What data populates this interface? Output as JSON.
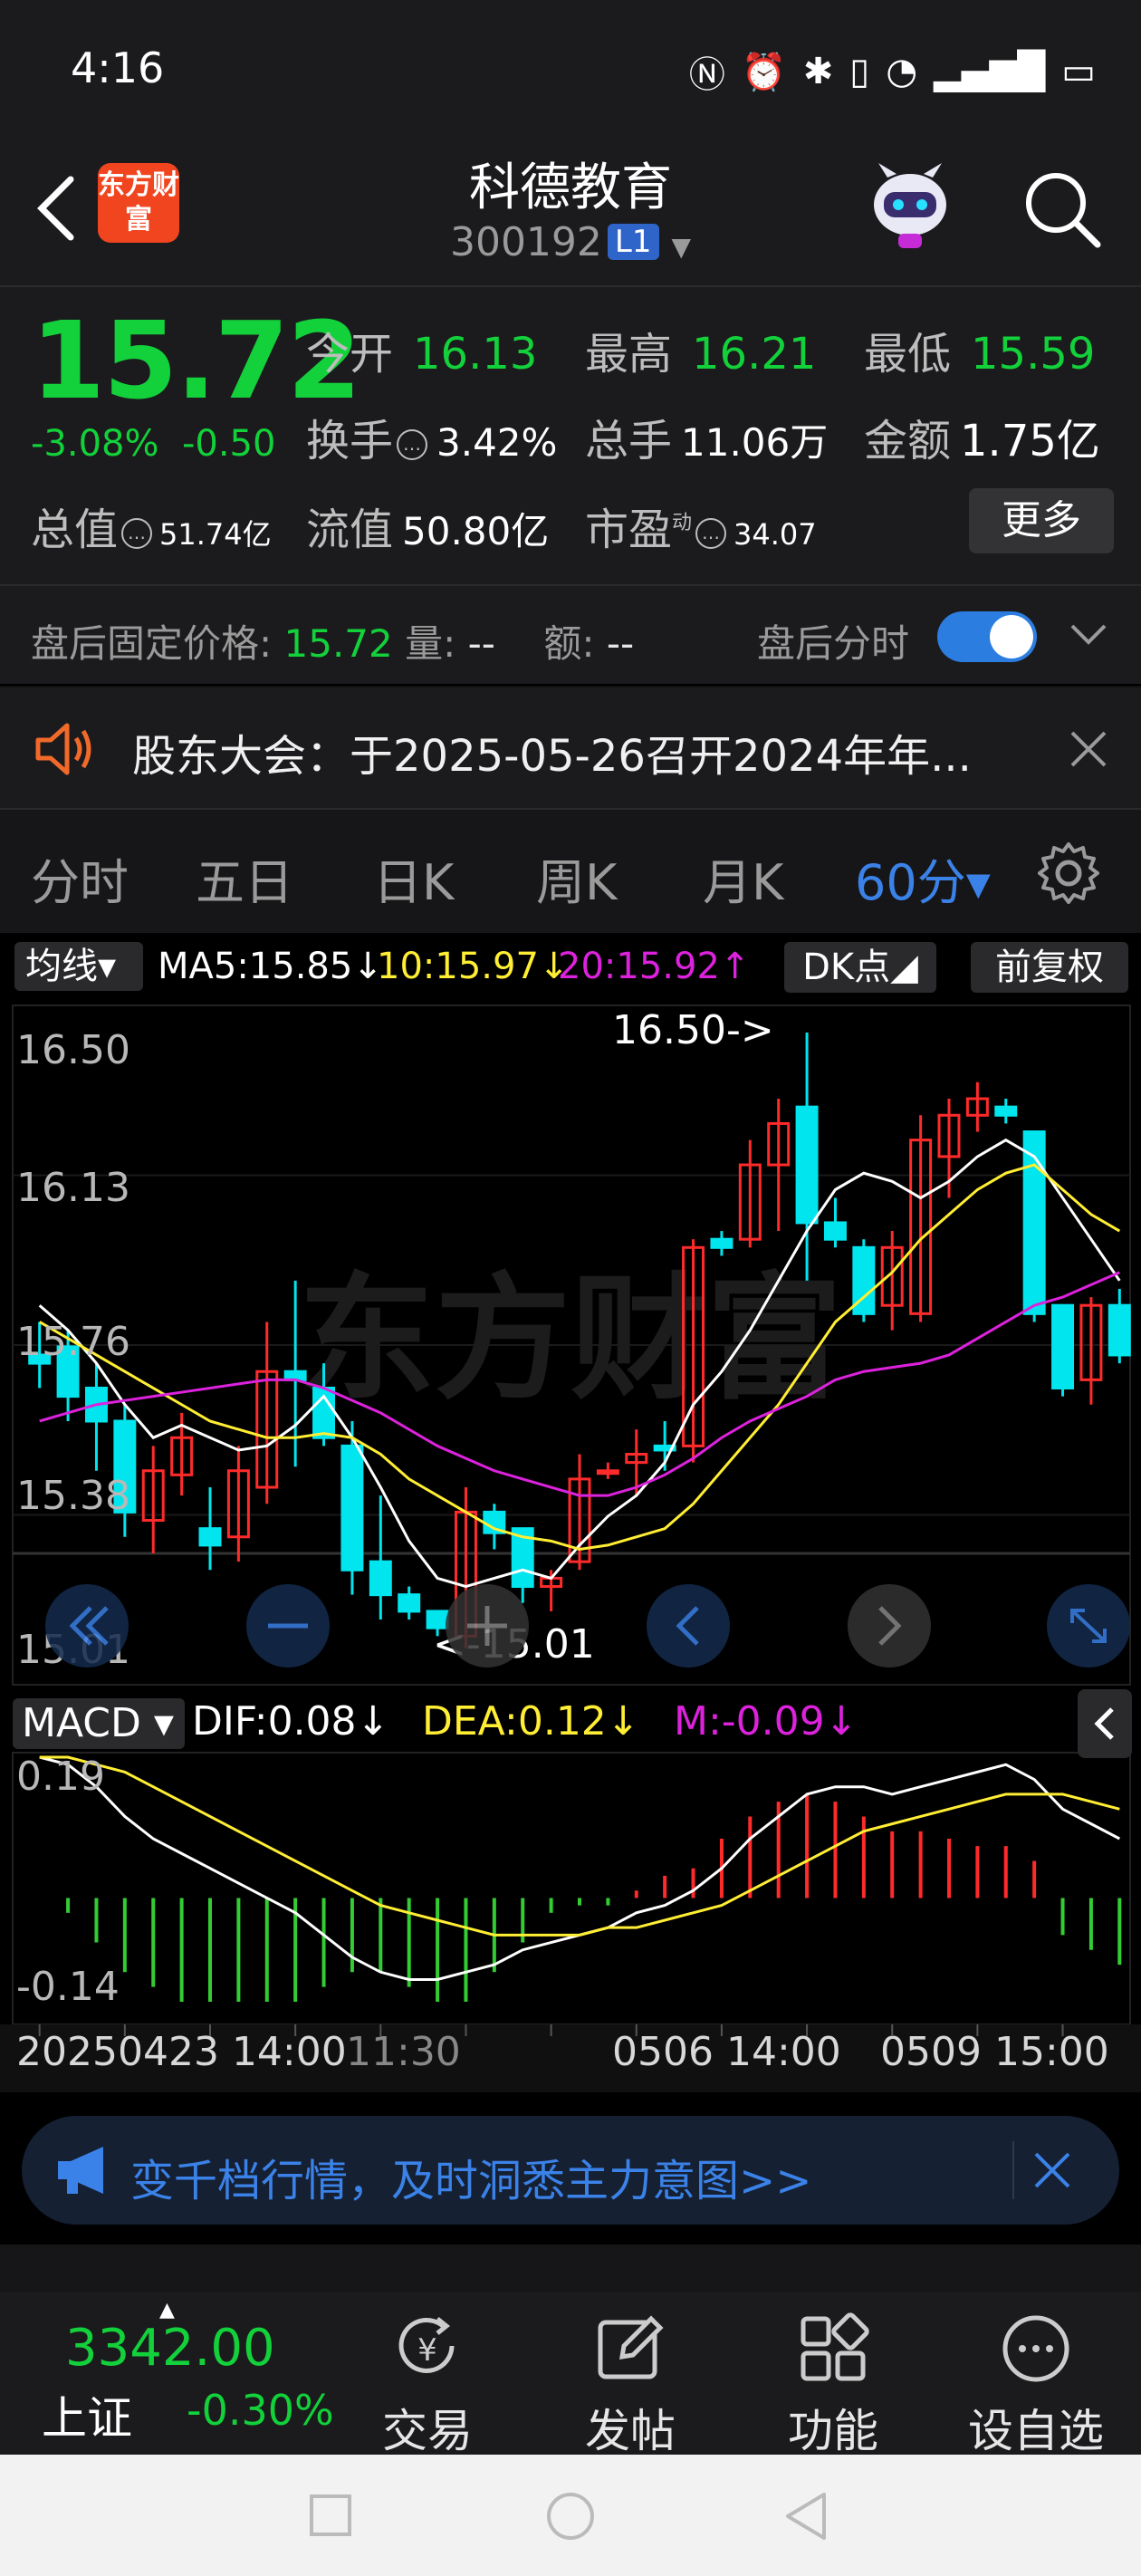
{
  "status_bar": {
    "time": "4:16"
  },
  "header": {
    "stock_name": "科德教育",
    "stock_code": "300192",
    "level_badge": "L1",
    "brand_text": "东方财富"
  },
  "quote": {
    "price": "15.72",
    "change_pct": "-3.08%",
    "change": "-0.50",
    "open_label": "今开",
    "open": "16.13",
    "high_label": "最高",
    "high": "16.21",
    "low_label": "最低",
    "low": "15.59",
    "turnover_label": "换手",
    "turnover": "3.42%",
    "volume_label": "总手",
    "volume": "11.06万",
    "amount_label": "金额",
    "amount": "1.75亿",
    "mktcap_label": "总值",
    "mktcap": "51.74亿",
    "float_label": "流值",
    "float": "50.80亿",
    "pe_label": "市盈",
    "pe_super": "动",
    "pe": "34.07",
    "more_label": "更多"
  },
  "after_hours": {
    "price_label": "盘后固定价格:",
    "price": "15.72",
    "volume_label": "量:",
    "volume": "--",
    "amount_label": "额:",
    "amount": "--",
    "minute_label": "盘后分时"
  },
  "notice": {
    "text": "股东大会：于2025-05-26召开2024年年..."
  },
  "period_tabs": [
    "分时",
    "五日",
    "日K",
    "周K",
    "月K",
    "60分▾"
  ],
  "ma_bar": {
    "selector": "均线▾",
    "ma5": "MA5:15.85↓",
    "ma10": "10:15.97↓",
    "ma20": "20:15.92↑",
    "dk": "DK点◢",
    "adjust": "前复权"
  },
  "price_axis": [
    "16.50",
    "16.13",
    "15.76",
    "15.38",
    "15.01"
  ],
  "annotations": {
    "high": "16.50->",
    "low": "<-15.01",
    "watermark": "东方财富"
  },
  "macd_bar": {
    "selector": "MACD ▾",
    "dif": "DIF:0.08↓",
    "dea": "DEA:0.12↓",
    "m": "M:-0.09↓"
  },
  "macd_axis": [
    "0.19",
    "-0.14"
  ],
  "time_axis": [
    "20250423 14:00",
    "11:30",
    "0506 14:00",
    "0509 15:00"
  ],
  "promo": {
    "text": "变千档行情，及时洞悉主力意图>>"
  },
  "bottom_nav": {
    "index_value": "3342.00",
    "index_name": "上证",
    "index_change": "-0.30%",
    "items": [
      "交易",
      "发帖",
      "功能",
      "设自选"
    ]
  },
  "colors": {
    "up": "#ff2b2b",
    "down": "#00e5ee",
    "ma5": "#ffffff",
    "ma10": "#ffee33",
    "ma20": "#dd22dd",
    "accent": "#3b82e8"
  },
  "chart_data": {
    "type": "candlestick",
    "interval": "60分",
    "ylim": [
      15.01,
      16.5
    ],
    "candles": [
      {
        "o": 15.72,
        "h": 15.8,
        "l": 15.64,
        "c": 15.7
      },
      {
        "o": 15.74,
        "h": 15.78,
        "l": 15.56,
        "c": 15.62
      },
      {
        "o": 15.64,
        "h": 15.7,
        "l": 15.44,
        "c": 15.56
      },
      {
        "o": 15.56,
        "h": 15.6,
        "l": 15.28,
        "c": 15.34
      },
      {
        "o": 15.32,
        "h": 15.5,
        "l": 15.24,
        "c": 15.44
      },
      {
        "o": 15.43,
        "h": 15.58,
        "l": 15.38,
        "c": 15.52
      },
      {
        "o": 15.3,
        "h": 15.4,
        "l": 15.2,
        "c": 15.26
      },
      {
        "o": 15.28,
        "h": 15.5,
        "l": 15.22,
        "c": 15.44
      },
      {
        "o": 15.4,
        "h": 15.8,
        "l": 15.36,
        "c": 15.68
      },
      {
        "o": 15.68,
        "h": 15.9,
        "l": 15.45,
        "c": 15.66
      },
      {
        "o": 15.64,
        "h": 15.7,
        "l": 15.5,
        "c": 15.52
      },
      {
        "o": 15.5,
        "h": 15.56,
        "l": 15.14,
        "c": 15.2
      },
      {
        "o": 15.22,
        "h": 15.38,
        "l": 15.08,
        "c": 15.14
      },
      {
        "o": 15.14,
        "h": 15.16,
        "l": 15.08,
        "c": 15.1
      },
      {
        "o": 15.1,
        "h": 15.1,
        "l": 15.04,
        "c": 15.06
      },
      {
        "o": 15.04,
        "h": 15.4,
        "l": 15.01,
        "c": 15.34
      },
      {
        "o": 15.34,
        "h": 15.36,
        "l": 15.25,
        "c": 15.29
      },
      {
        "o": 15.3,
        "h": 15.3,
        "l": 15.12,
        "c": 15.16
      },
      {
        "o": 15.16,
        "h": 15.2,
        "l": 15.1,
        "c": 15.18
      },
      {
        "o": 15.22,
        "h": 15.48,
        "l": 15.2,
        "c": 15.42
      },
      {
        "o": 15.44,
        "h": 15.46,
        "l": 15.42,
        "c": 15.44
      },
      {
        "o": 15.46,
        "h": 15.54,
        "l": 15.38,
        "c": 15.48
      },
      {
        "o": 15.5,
        "h": 15.56,
        "l": 15.44,
        "c": 15.49
      },
      {
        "o": 15.5,
        "h": 16.0,
        "l": 15.46,
        "c": 15.98
      },
      {
        "o": 16.0,
        "h": 16.02,
        "l": 15.96,
        "c": 15.98
      },
      {
        "o": 16.0,
        "h": 16.24,
        "l": 15.98,
        "c": 16.18
      },
      {
        "o": 16.18,
        "h": 16.34,
        "l": 16.02,
        "c": 16.28
      },
      {
        "o": 16.32,
        "h": 16.5,
        "l": 15.9,
        "c": 16.04
      },
      {
        "o": 16.04,
        "h": 16.1,
        "l": 15.98,
        "c": 16.0
      },
      {
        "o": 15.98,
        "h": 16.0,
        "l": 15.8,
        "c": 15.82
      },
      {
        "o": 15.84,
        "h": 16.02,
        "l": 15.78,
        "c": 15.98
      },
      {
        "o": 15.82,
        "h": 16.3,
        "l": 15.8,
        "c": 16.24
      },
      {
        "o": 16.2,
        "h": 16.34,
        "l": 16.1,
        "c": 16.3
      },
      {
        "o": 16.3,
        "h": 16.38,
        "l": 16.26,
        "c": 16.34
      },
      {
        "o": 16.32,
        "h": 16.34,
        "l": 16.28,
        "c": 16.3
      },
      {
        "o": 16.26,
        "h": 16.26,
        "l": 15.8,
        "c": 15.82
      },
      {
        "o": 15.84,
        "h": 15.84,
        "l": 15.62,
        "c": 15.64
      },
      {
        "o": 15.66,
        "h": 15.86,
        "l": 15.6,
        "c": 15.84
      },
      {
        "o": 15.84,
        "h": 15.88,
        "l": 15.7,
        "c": 15.72
      }
    ],
    "ma5": [
      15.84,
      15.78,
      15.7,
      15.6,
      15.52,
      15.55,
      15.52,
      15.49,
      15.5,
      15.55,
      15.62,
      15.52,
      15.4,
      15.27,
      15.18,
      15.16,
      15.18,
      15.2,
      15.18,
      15.26,
      15.33,
      15.38,
      15.46,
      15.6,
      15.68,
      15.78,
      15.9,
      16.02,
      16.12,
      16.16,
      16.14,
      16.1,
      16.14,
      16.2,
      16.24,
      16.2,
      16.1,
      16.0,
      15.9
    ],
    "ma10": [
      15.8,
      15.76,
      15.72,
      15.68,
      15.64,
      15.6,
      15.56,
      15.54,
      15.52,
      15.52,
      15.53,
      15.52,
      15.48,
      15.42,
      15.38,
      15.34,
      15.3,
      15.28,
      15.27,
      15.25,
      15.26,
      15.28,
      15.3,
      15.36,
      15.44,
      15.52,
      15.6,
      15.7,
      15.8,
      15.86,
      15.92,
      16.0,
      16.06,
      16.12,
      16.16,
      16.18,
      16.12,
      16.06,
      16.02
    ],
    "ma20": [
      15.56,
      15.58,
      15.6,
      15.61,
      15.62,
      15.63,
      15.64,
      15.65,
      15.66,
      15.66,
      15.64,
      15.61,
      15.58,
      15.54,
      15.5,
      15.47,
      15.44,
      15.42,
      15.4,
      15.38,
      15.38,
      15.4,
      15.43,
      15.47,
      15.52,
      15.56,
      15.59,
      15.62,
      15.66,
      15.68,
      15.69,
      15.7,
      15.72,
      15.76,
      15.8,
      15.84,
      15.86,
      15.89,
      15.92
    ],
    "macd": {
      "ylim": [
        -0.14,
        0.19
      ],
      "dif": [
        0.19,
        0.18,
        0.15,
        0.11,
        0.08,
        0.06,
        0.04,
        0.02,
        0.0,
        -0.02,
        -0.05,
        -0.08,
        -0.1,
        -0.11,
        -0.11,
        -0.1,
        -0.09,
        -0.07,
        -0.06,
        -0.05,
        -0.04,
        -0.02,
        -0.01,
        0.01,
        0.04,
        0.08,
        0.11,
        0.14,
        0.15,
        0.15,
        0.14,
        0.15,
        0.16,
        0.17,
        0.18,
        0.16,
        0.12,
        0.1,
        0.08
      ],
      "dea": [
        0.19,
        0.19,
        0.18,
        0.17,
        0.15,
        0.13,
        0.11,
        0.09,
        0.07,
        0.05,
        0.03,
        0.01,
        -0.01,
        -0.02,
        -0.03,
        -0.04,
        -0.05,
        -0.05,
        -0.05,
        -0.05,
        -0.04,
        -0.04,
        -0.03,
        -0.02,
        -0.01,
        0.01,
        0.03,
        0.05,
        0.07,
        0.09,
        0.1,
        0.11,
        0.12,
        0.13,
        0.14,
        0.14,
        0.14,
        0.13,
        0.12
      ],
      "hist": [
        0.0,
        -0.02,
        -0.06,
        -0.1,
        -0.12,
        -0.14,
        -0.14,
        -0.14,
        -0.14,
        -0.14,
        -0.12,
        -0.1,
        -0.1,
        -0.12,
        -0.14,
        -0.14,
        -0.1,
        -0.06,
        -0.02,
        -0.01,
        -0.01,
        0.01,
        0.03,
        0.04,
        0.08,
        0.11,
        0.13,
        0.14,
        0.13,
        0.11,
        0.09,
        0.09,
        0.08,
        0.07,
        0.07,
        0.05,
        -0.05,
        -0.07,
        -0.09
      ]
    }
  }
}
